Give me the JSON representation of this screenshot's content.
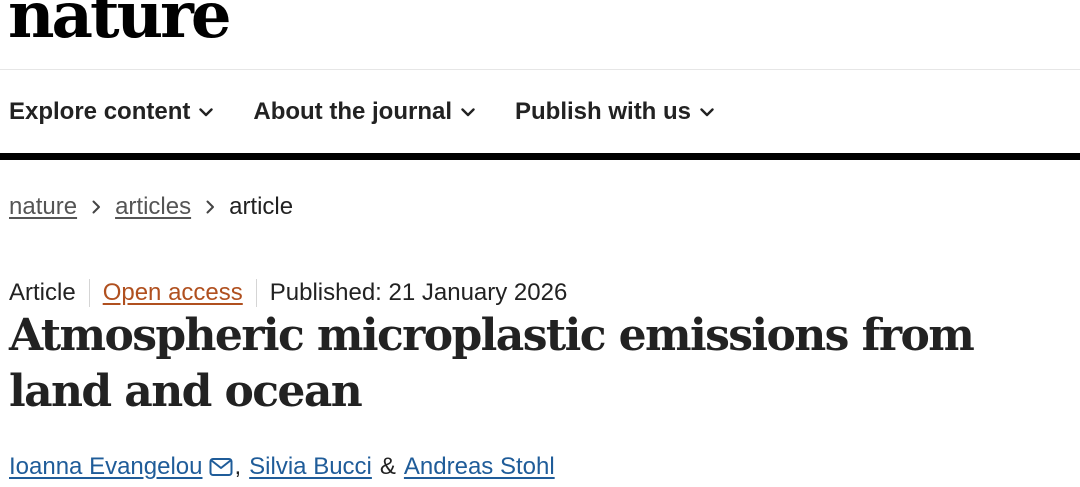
{
  "logo": {
    "text": "nature"
  },
  "nav": {
    "items": [
      {
        "label": "Explore content",
        "icon": "chevron-down-icon"
      },
      {
        "label": "About the journal",
        "icon": "chevron-down-icon"
      },
      {
        "label": "Publish with us",
        "icon": "chevron-down-icon"
      }
    ]
  },
  "breadcrumb": {
    "items": [
      {
        "label": "nature",
        "link": true
      },
      {
        "label": "articles",
        "link": true
      },
      {
        "label": "article",
        "link": false
      }
    ],
    "separator_icon": "chevron-right-icon"
  },
  "article": {
    "type": "Article",
    "access": "Open access",
    "published": "Published: 21 January 2026",
    "title": "Atmospheric microplastic emissions from land and ocean",
    "authors": [
      {
        "name": "Ioanna Evangelou",
        "icon": "mail-icon"
      },
      {
        "name": "Silvia Bucci"
      },
      {
        "name": "Andreas Stohl"
      }
    ],
    "author_sep_1": ",",
    "author_sep_2": "&"
  },
  "colors": {
    "text": "#222222",
    "open_access": "#b0501f",
    "author_link": "#1f5c99",
    "breadcrumb_link": "#555555",
    "rule": "#000000"
  }
}
